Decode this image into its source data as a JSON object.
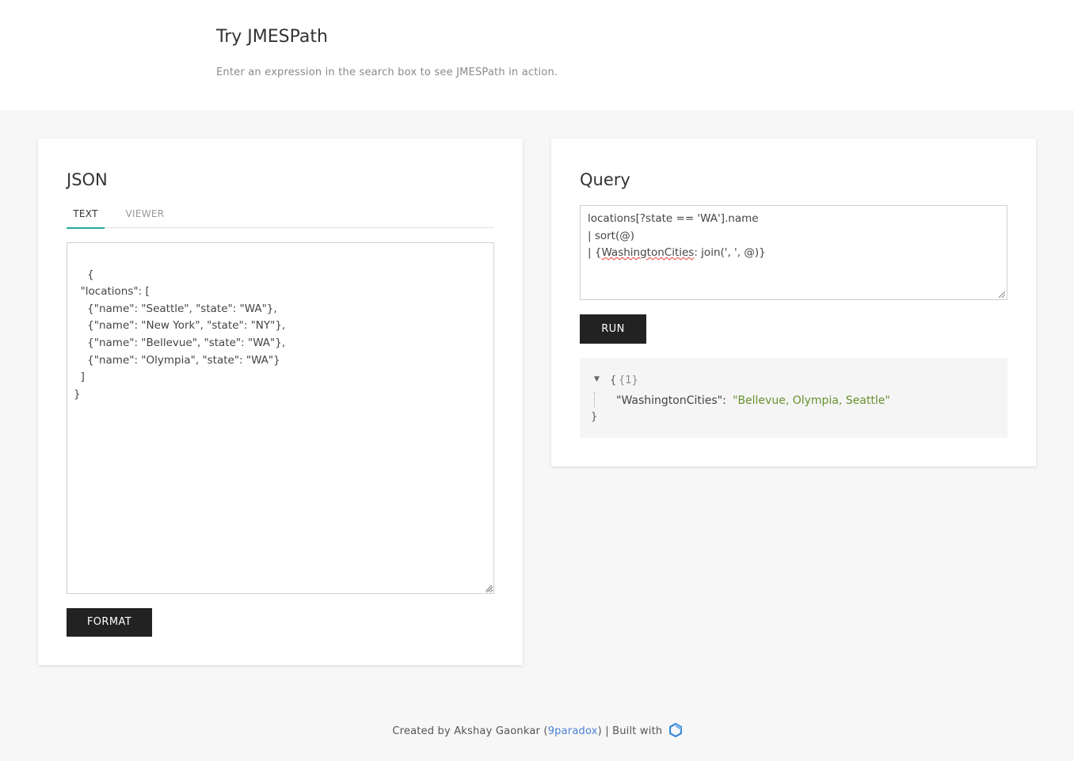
{
  "header": {
    "title": "Try JMESPath",
    "subtitle": "Enter an expression in the search box to see JMESPath in action."
  },
  "json_panel": {
    "title": "JSON",
    "tabs": [
      {
        "label": "TEXT",
        "active": true
      },
      {
        "label": "VIEWER",
        "active": false
      }
    ],
    "content": "{\n  \"locations\": [\n    {\"name\": \"Seattle\", \"state\": \"WA\"},\n    {\"name\": \"New York\", \"state\": \"NY\"},\n    {\"name\": \"Bellevue\", \"state\": \"WA\"},\n    {\"name\": \"Olympia\", \"state\": \"WA\"}\n  ]\n}",
    "format_label": "FORMAT"
  },
  "query_panel": {
    "title": "Query",
    "query_lines": [
      "locations[?state == 'WA'].name",
      "| sort(@)",
      "| {",
      "WashingtonCities",
      ": join(', ', @)}"
    ],
    "run_label": "RUN",
    "result": {
      "open_brace": "{",
      "count": "{1}",
      "key": "\"WashingtonCities\": ",
      "value": "\"Bellevue, Olympia, Seattle\"",
      "close_brace": "}"
    }
  },
  "footer": {
    "prefix": "Created by Akshay Gaonkar (",
    "link": "9paradox",
    "suffix": ") | Built with",
    "logo_icon": "hexagon-logo-icon"
  },
  "colors": {
    "accent_tab": "#26a69a",
    "button_bg": "#222222",
    "link": "#4a7fd6",
    "string_value": "#66922e"
  }
}
